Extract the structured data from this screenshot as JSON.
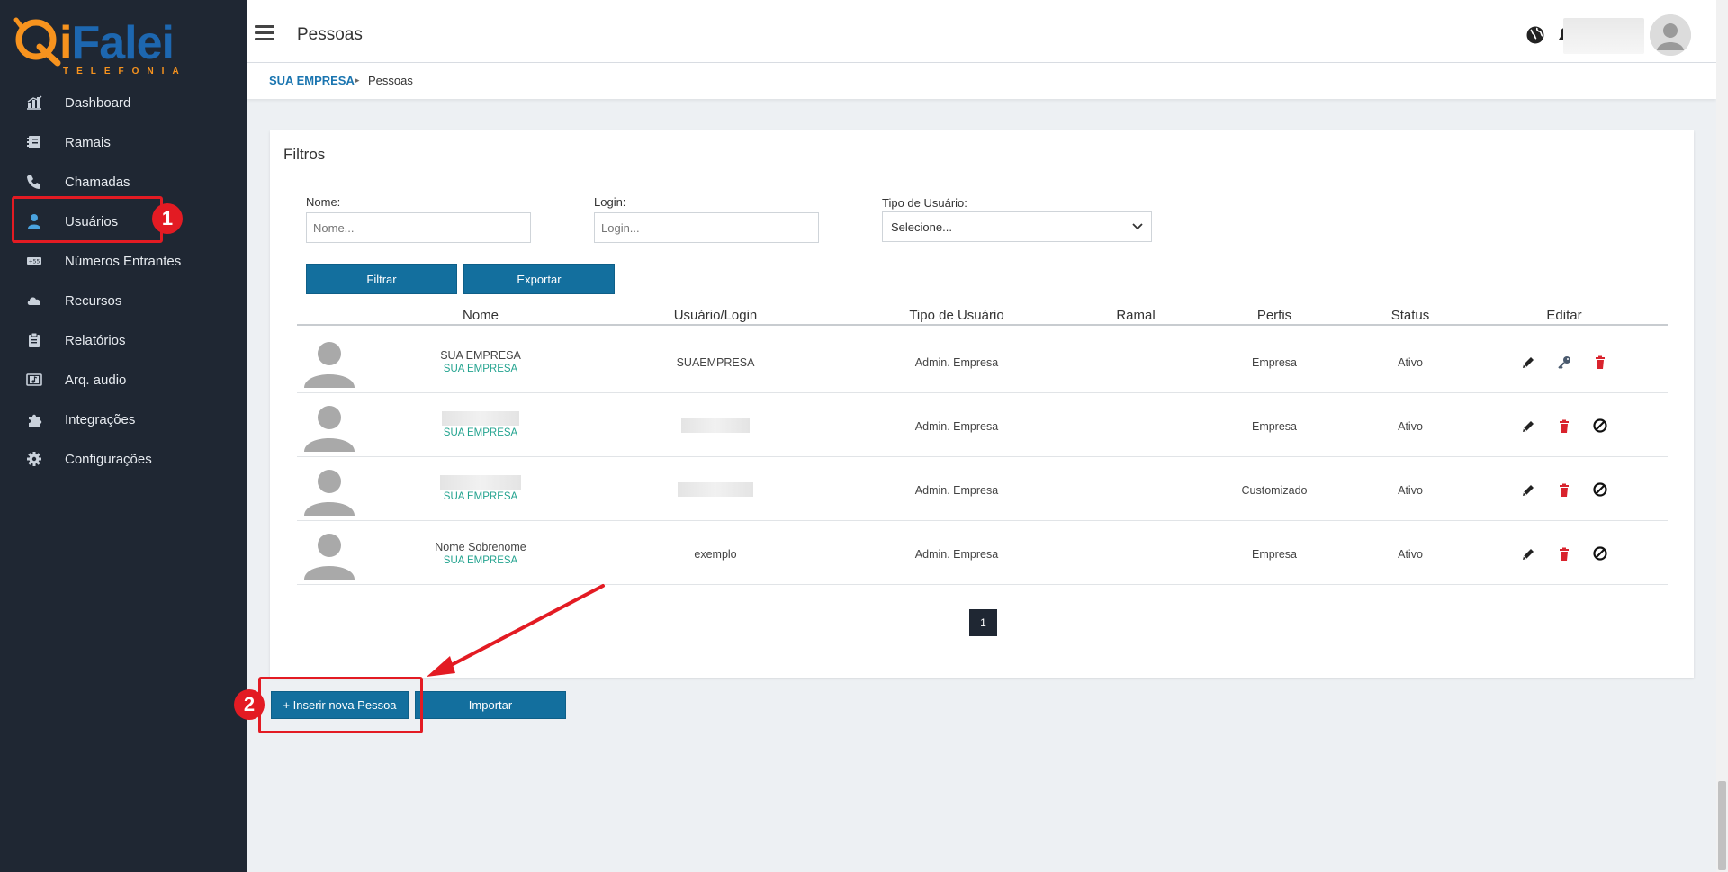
{
  "app": {
    "logo_text": "iFalei",
    "logo_sub": "TELEFONIA"
  },
  "sidebar": {
    "items": [
      {
        "label": "Dashboard",
        "icon": "chart-icon"
      },
      {
        "label": "Ramais",
        "icon": "phonebook-icon"
      },
      {
        "label": "Chamadas",
        "icon": "phone-icon"
      },
      {
        "label": "Usuários",
        "icon": "user-icon"
      },
      {
        "label": "Números Entrantes",
        "icon": "did-icon"
      },
      {
        "label": "Recursos",
        "icon": "cloud-icon"
      },
      {
        "label": "Relatórios",
        "icon": "clipboard-icon"
      },
      {
        "label": "Arq. audio",
        "icon": "audio-file-icon"
      },
      {
        "label": "Integrações",
        "icon": "puzzle-icon"
      },
      {
        "label": "Configurações",
        "icon": "gear-icon"
      }
    ]
  },
  "header": {
    "title": "Pessoas"
  },
  "breadcrumb": {
    "company": "SUA EMPRESA",
    "current": "Pessoas"
  },
  "filters": {
    "title": "Filtros",
    "nome_label": "Nome:",
    "nome_placeholder": "Nome...",
    "login_label": "Login:",
    "login_placeholder": "Login...",
    "tipo_label": "Tipo de Usuário:",
    "tipo_selected": "Selecione...",
    "filtrar": "Filtrar",
    "exportar": "Exportar"
  },
  "table": {
    "headers": [
      "Nome",
      "Usuário/Login",
      "Tipo de Usuário",
      "Ramal",
      "Perfis",
      "Status",
      "Editar"
    ],
    "rows": [
      {
        "name": "SUA EMPRESA",
        "company": "SUA EMPRESA",
        "login": "SUAEMPRESA",
        "tipo": "Admin. Empresa",
        "ramal": "",
        "perfil": "Empresa",
        "status": "Ativo",
        "actions": [
          "edit",
          "key",
          "delete"
        ]
      },
      {
        "name": "",
        "company": "SUA EMPRESA",
        "login": "",
        "tipo": "Admin. Empresa",
        "ramal": "",
        "perfil": "Empresa",
        "status": "Ativo",
        "actions": [
          "edit",
          "delete",
          "block"
        ]
      },
      {
        "name": "",
        "company": "SUA EMPRESA",
        "login": "",
        "tipo": "Admin. Empresa",
        "ramal": "",
        "perfil": "Customizado",
        "status": "Ativo",
        "actions": [
          "edit",
          "delete",
          "block"
        ]
      },
      {
        "name": "Nome Sobrenome",
        "company": "SUA EMPRESA",
        "login": "exemplo",
        "tipo": "Admin. Empresa",
        "ramal": "",
        "perfil": "Empresa",
        "status": "Ativo",
        "actions": [
          "edit",
          "delete",
          "block"
        ]
      }
    ]
  },
  "pagination": {
    "current": "1"
  },
  "actions": {
    "insert": "+ Inserir nova Pessoa",
    "import": "Importar"
  },
  "annotations": {
    "badge1": "1",
    "badge2": "2"
  },
  "colors": {
    "sidebar_bg": "#1f2733",
    "primary": "#136f9e",
    "accent": "#f7931e",
    "annotation": "#e31b23"
  }
}
